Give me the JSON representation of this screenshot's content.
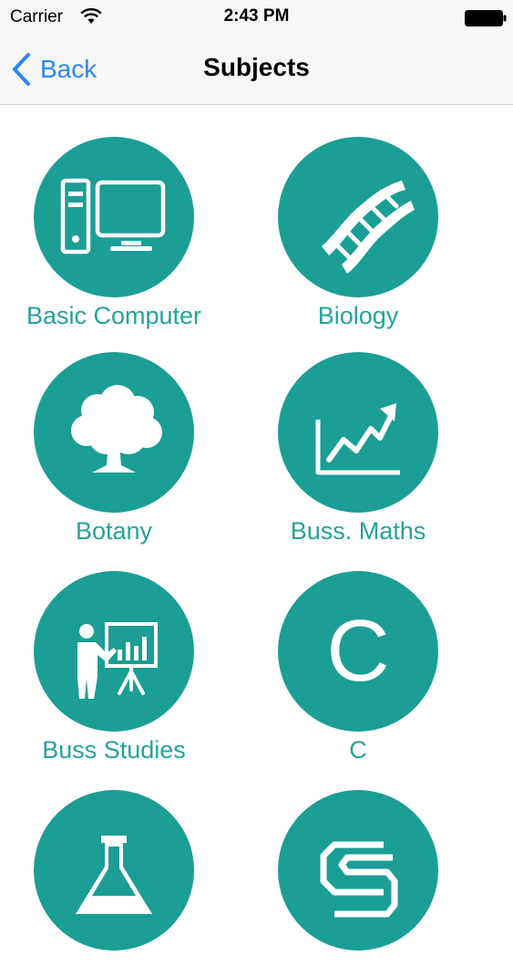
{
  "status_bar": {
    "carrier": "Carrier",
    "time": "2:43 PM"
  },
  "nav": {
    "back_label": "Back",
    "title": "Subjects"
  },
  "subjects": [
    {
      "label": "Basic Computer",
      "icon": "computer-icon"
    },
    {
      "label": "Biology",
      "icon": "dna-icon"
    },
    {
      "label": "Botany",
      "icon": "tree-icon"
    },
    {
      "label": "Buss. Maths",
      "icon": "growth-chart-icon"
    },
    {
      "label": "Buss Studies",
      "icon": "presentation-icon"
    },
    {
      "label": "C",
      "icon": "letter-c-icon"
    },
    {
      "label": "",
      "icon": "flask-icon"
    },
    {
      "label": "",
      "icon": "cs-logo-icon"
    }
  ],
  "colors": {
    "tile_circle": "#1a9e96",
    "tile_label": "#24a39a",
    "nav_tint": "#2b88f5"
  }
}
